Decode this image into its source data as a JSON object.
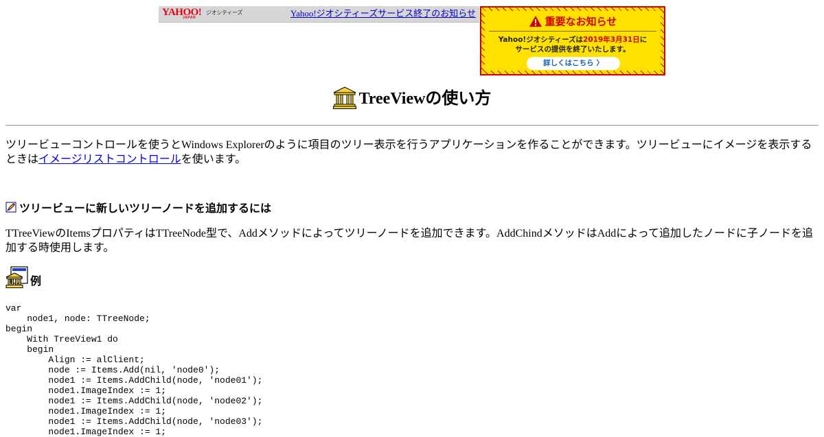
{
  "banner": {
    "logo_text": "YAHOO!",
    "logo_sub": "JAPAN",
    "logo_service": "ジオシティーズ",
    "link_text": "Yahoo!ジオシティーズサービス終了のお知らせ"
  },
  "notice": {
    "title": "重要なお知らせ",
    "line1_pre": "Yahoo!ジオシティーズは",
    "line1_date": "2019年3月31日",
    "line1_post": "に",
    "line2": "サービスの提供を終了いたします。",
    "button": "詳しくはこちら",
    "button_arrow": "〉"
  },
  "colors": {
    "link": "#0000ee",
    "notice_red": "#d40000",
    "notice_yellow": "#ffe100"
  },
  "page": {
    "title": "TreeViewの使い方",
    "intro_pre": "ツリービューコントロールを使うとWindows Explorerのように項目のツリー表示を行うアプリケーションを作ることができます。ツリービューにイメージを表示するときは",
    "intro_link": "イメージリストコントロール",
    "intro_post": "を使います。",
    "section_title": "ツリービューに新しいツリーノードを追加するには",
    "section_body": "TTreeViewのItemsプロパティはTTreeNode型で、Addメソッドによってツリーノードを追加できます。AddChindメソッドはAddによって追加したノードに子ノードを追加する時使用します。",
    "example_label": "例",
    "code": "var\n    node1, node: TTreeNode;\nbegin\n    With TreeView1 do\n    begin\n        Align := alClient;\n        node := Items.Add(nil, 'node0');\n        node1 := Items.AddChild(node, 'node01');\n        node1.ImageIndex := 1;\n        node1 := Items.AddChild(node, 'node02');\n        node1.ImageIndex := 1;\n        node1 := Items.AddChild(node, 'node03');\n        node1.ImageIndex := 1;"
  },
  "icons": {
    "title": "bank-building-icon",
    "section": "pencil-icon",
    "example": "document-building-icon",
    "notice": "warning-icon"
  }
}
